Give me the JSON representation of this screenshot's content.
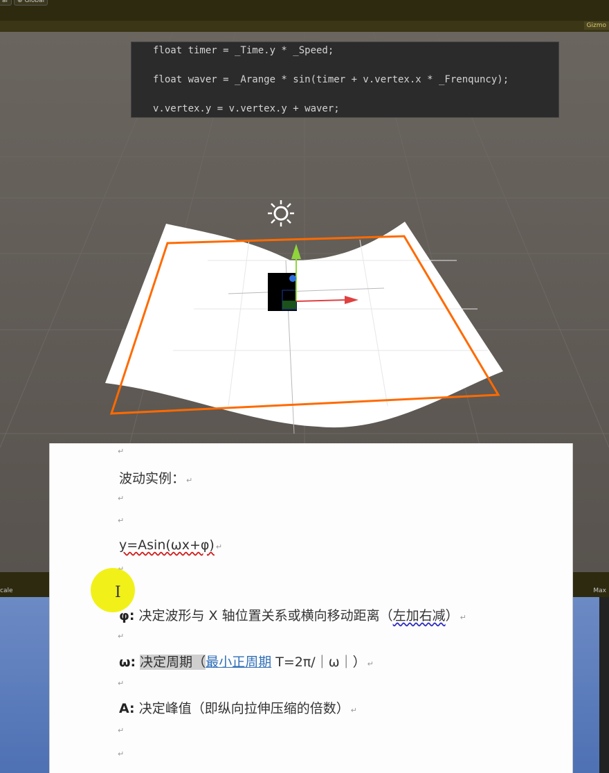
{
  "toolbar": {
    "btn_left": "ar",
    "btn_global": "⊕ Global"
  },
  "scene": {
    "gizmos_label": "Gizmo"
  },
  "code": {
    "lines": [
      "float timer = _Time.y * _Speed;",
      "float waver = _Arange * sin(timer + v.vertex.x * _Frenquncy);",
      "v.vertex.y = v.vertex.y + waver;"
    ]
  },
  "game": {
    "scale_label": "cale",
    "max_label": "Max"
  },
  "doc": {
    "heading": "波动实例：",
    "formula": "y=Asin(ωx+φ)",
    "phi_sym": "φ:",
    "phi_text_pre": " 决定波形与 X 轴位置关系或横向移动距离（",
    "phi_text_squiggle": "左加右减",
    "phi_text_post": "）",
    "omega_sym": "ω:",
    "omega_hl": "决定周期（",
    "omega_link": "最小正周期",
    "omega_post": " T=2π/｜ω｜）",
    "a_sym": "A:",
    "a_text": " 决定峰值（即纵向拉伸压缩的倍数）",
    "return_mark": "↵"
  },
  "colors": {
    "selection_outline": "#ff6a00",
    "scene_bg": "#5f5a55",
    "code_bg": "#2b2b2b",
    "highlight_cursor": "#f0f000"
  }
}
